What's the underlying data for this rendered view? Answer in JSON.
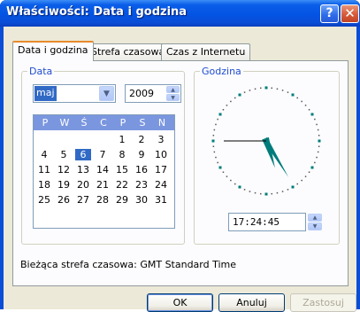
{
  "window": {
    "title": "Właściwości: Data i godzina"
  },
  "tabs": [
    {
      "label": "Data i godzina",
      "active": true
    },
    {
      "label": "Strefa czasowa",
      "active": false
    },
    {
      "label": "Czas z Internetu",
      "active": false
    }
  ],
  "date_group": {
    "label": "Data",
    "month": "maj",
    "year": "2009",
    "weekdays": [
      "P",
      "W",
      "Ś",
      "C",
      "P",
      "S",
      "N"
    ],
    "weeks": [
      [
        "",
        "",
        "",
        "",
        "1",
        "2",
        "3"
      ],
      [
        "4",
        "5",
        "6",
        "7",
        "8",
        "9",
        "10"
      ],
      [
        "11",
        "12",
        "13",
        "14",
        "15",
        "16",
        "17"
      ],
      [
        "18",
        "19",
        "20",
        "21",
        "22",
        "23",
        "24"
      ],
      [
        "25",
        "26",
        "27",
        "28",
        "29",
        "30",
        "31"
      ]
    ],
    "selected_day": "6"
  },
  "time_group": {
    "label": "Godzina",
    "time": "17:24:45",
    "clock": {
      "hours": 17,
      "minutes": 24,
      "seconds": 45
    }
  },
  "status": {
    "text": "Bieżąca strefa czasowa: GMT Standard Time"
  },
  "buttons": {
    "ok": "OK",
    "cancel": "Anuluj",
    "apply": "Zastosuj"
  },
  "colors": {
    "accent": "#316ac5",
    "clock_hands": "#007b7b",
    "group_label": "#1f4ccd"
  },
  "icons": {
    "help": "help-icon",
    "close": "close-icon"
  }
}
